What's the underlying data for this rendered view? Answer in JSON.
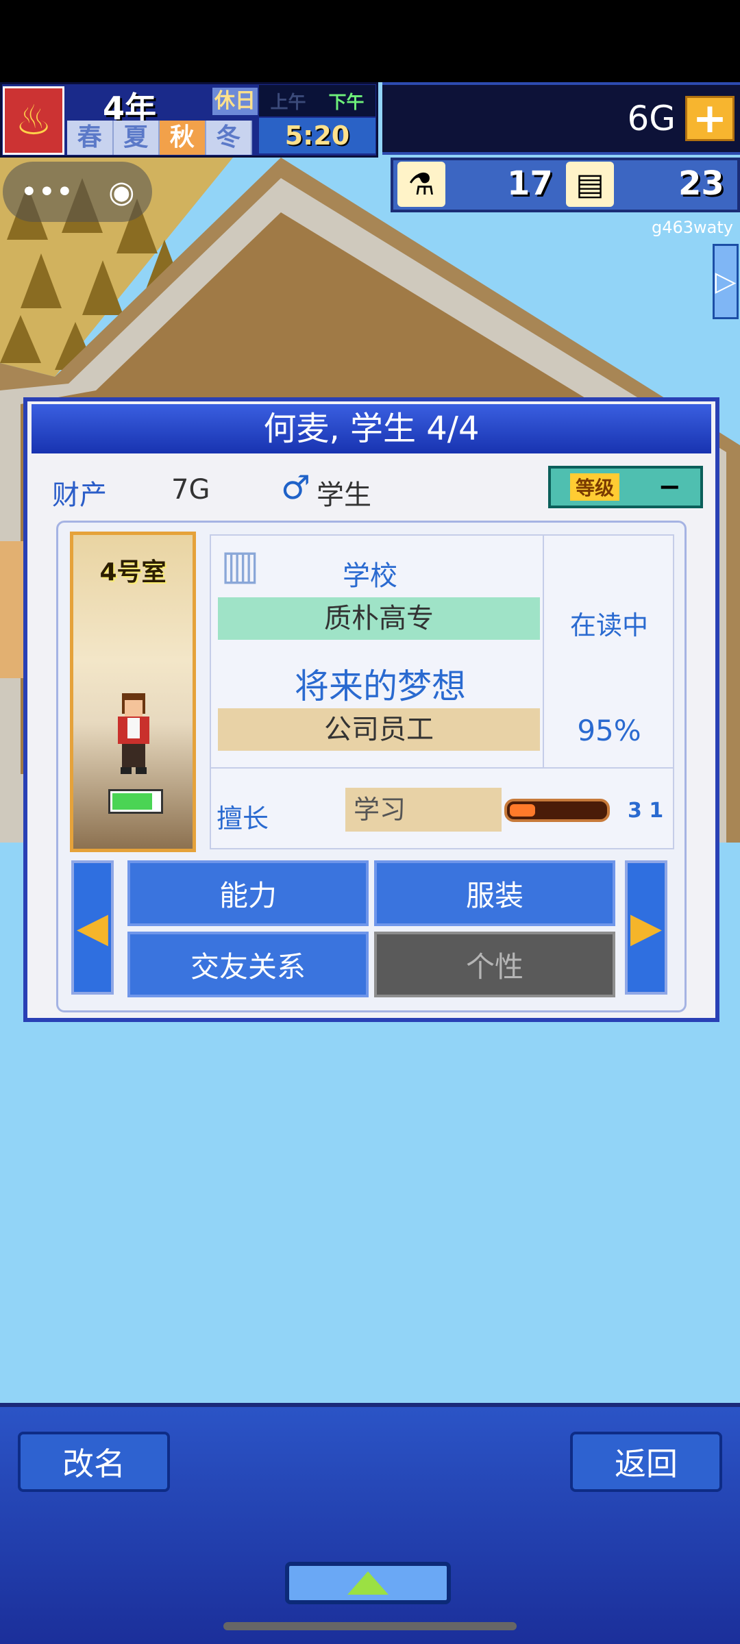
{
  "hud": {
    "year": "4年",
    "holiday": "休日",
    "am": "上午",
    "pm": "下午",
    "seasons": [
      "春",
      "夏",
      "秋",
      "冬"
    ],
    "active_season_index": 2,
    "time": "5:20",
    "money": "6G",
    "plus_symbol": "+",
    "research_points": "17",
    "tickets": "23",
    "username": "g463waty"
  },
  "dialog": {
    "title": "何麦, 学生 4/4",
    "wealth_label": "财产",
    "wealth_value": "7G",
    "role": "学生",
    "level_label": "等级",
    "level_symbol": "−",
    "room": "4号室",
    "school_label": "学校",
    "school_name": "质朴高专",
    "status": "在读中",
    "dream_label": "将来的梦想",
    "dream_job": "公司员工",
    "progress_percent": "95%",
    "skill_label": "擅长",
    "skill_value": "学习",
    "skill_level": "3 1",
    "skill_fill_fraction": 0.27,
    "buttons": {
      "ability": "能力",
      "clothing": "服装",
      "friends": "交友关系",
      "personality": "个性"
    }
  },
  "bottom": {
    "rename": "改名",
    "back": "返回"
  },
  "colors": {
    "sky": "#92d4f7",
    "dialog_header": "#1833b0",
    "accent_orange": "#f2a14a"
  }
}
